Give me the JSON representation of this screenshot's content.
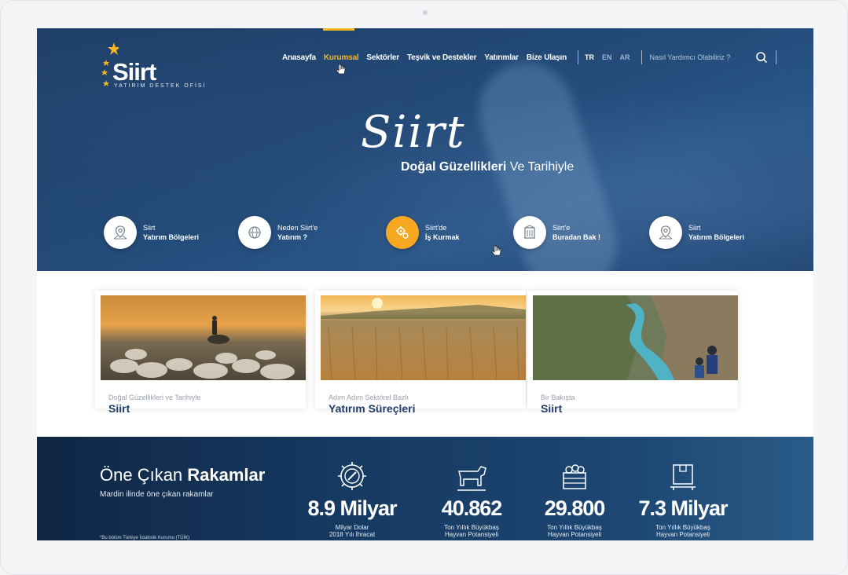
{
  "logo": {
    "word": "Siirt",
    "subtitle": "YATIRIM DESTEK OFİSİ"
  },
  "nav": {
    "items": [
      {
        "label": "Anasayfa"
      },
      {
        "label": "Kurumsal"
      },
      {
        "label": "Sektörler"
      },
      {
        "label": "Teşvik ve Destekler"
      },
      {
        "label": "Yatırımlar"
      },
      {
        "label": "Bize Ulaşın"
      }
    ],
    "active": "Kurumsal",
    "languages": [
      "TR",
      "EN",
      "AR"
    ],
    "selected_language": "TR",
    "search_placeholder": "Nasıl Yardımcı Olabiliriz ?"
  },
  "hero": {
    "script_title": "Siirt",
    "tagline_bold": "Doğal Güzellikleri",
    "tagline_rest": " Ve Tarihiyle"
  },
  "features": [
    {
      "line1": "Siirt",
      "line2": "Yatırım Bölgeleri",
      "icon": "map-pin-icon"
    },
    {
      "line1": "Neden Siirt'e",
      "line2": "Yatırım ?",
      "icon": "globe-icon"
    },
    {
      "line1": "Siirt'de",
      "line2": "İş Kurmak",
      "icon": "gears-icon"
    },
    {
      "line1": "Siirt'e",
      "line2": "Buradan Bak !",
      "icon": "building-icon"
    },
    {
      "line1": "Siirt",
      "line2": "Yatırım Bölgeleri",
      "icon": "map-pin-icon"
    }
  ],
  "cards": [
    {
      "subtitle": "Doğal Güzellikleri ve Tarihiyle",
      "title": "Siirt"
    },
    {
      "subtitle": "Adım Adım Sektörel Bazlı",
      "title": "Yatırım Süreçleri"
    },
    {
      "subtitle": "Bir Bakışta",
      "title": "Siirt"
    }
  ],
  "stats": {
    "title_light": "Öne Çıkan ",
    "title_bold": "Rakamlar",
    "subtitle": "Mardin ilinde öne çıkan rakamlar",
    "note": "*Bu bölüm Türkiye İstatistik Kurumu (TÜİK)",
    "items": [
      {
        "value": "8.9 Milyar",
        "caption": "Milyar Dolar",
        "caption2": "2018 Yılı İhracat",
        "icon": "gear-wrench-icon"
      },
      {
        "value": "40.862",
        "caption": "Ton Yıllık Büyükbaş",
        "caption2": "Hayvan Potansiyeli",
        "icon": "cow-icon"
      },
      {
        "value": "29.800",
        "caption": "Ton Yıllık Büyükbaş",
        "caption2": "Hayvan Potansiyeli",
        "icon": "crate-icon"
      },
      {
        "value": "7.3 Milyar",
        "caption": "Ton Yıllık Büyükbaş",
        "caption2": "Hayvan Potansiyeli",
        "icon": "box-icon"
      }
    ]
  },
  "colors": {
    "accent": "#f6b521",
    "navy": "#1f3d66",
    "hero": "#234a78"
  }
}
